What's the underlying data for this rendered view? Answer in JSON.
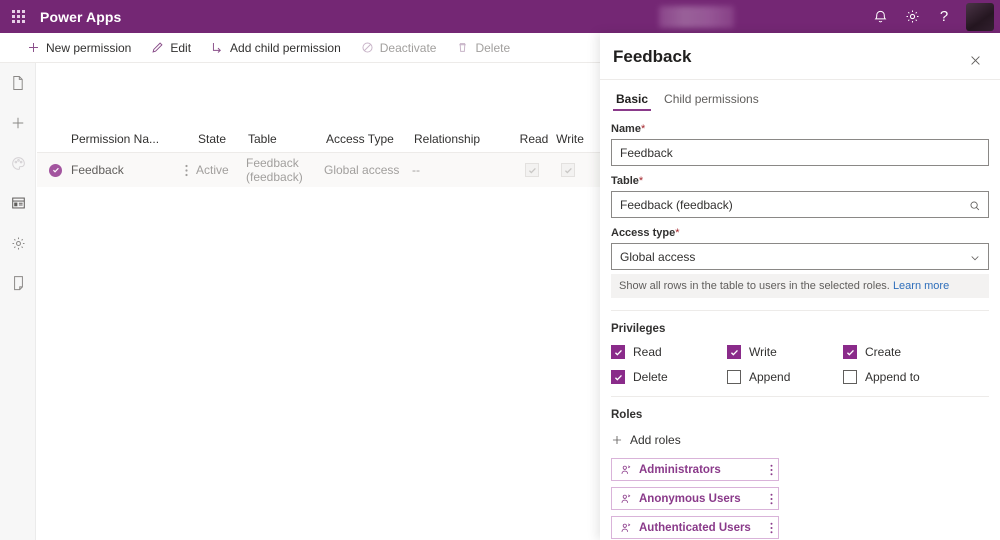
{
  "suite": {
    "waffle_icon": "waffle-grid-icon",
    "title": "Power Apps",
    "notifications_icon": "bell-icon",
    "settings_icon": "gear-icon",
    "help_icon": "question-mark-icon",
    "avatar_label": "",
    "brand_color": "#742774"
  },
  "commandbar": {
    "items": [
      {
        "label": "New permission",
        "icon": "plus-icon",
        "disabled": false
      },
      {
        "label": "Edit",
        "icon": "pencil-icon",
        "disabled": false
      },
      {
        "label": "Add child permission",
        "icon": "add-child-icon",
        "disabled": false
      },
      {
        "label": "Deactivate",
        "icon": "block-circle-icon",
        "disabled": true
      },
      {
        "label": "Delete",
        "icon": "trash-icon",
        "disabled": true
      }
    ]
  },
  "rail": {
    "items": [
      {
        "name": "pages-icon",
        "state": "normal"
      },
      {
        "name": "plus-icon",
        "state": "normal"
      },
      {
        "name": "theme-icon",
        "state": "muted"
      },
      {
        "name": "components-icon",
        "state": "dark"
      },
      {
        "name": "settings-icon",
        "state": "normal"
      },
      {
        "name": "preview-icon",
        "state": "normal"
      }
    ]
  },
  "grid": {
    "columns": [
      "Permission Na...",
      "State",
      "Table",
      "Access Type",
      "Relationship",
      "Read",
      "Write"
    ],
    "rows": [
      {
        "name": "Feedback",
        "state": "Active",
        "table": "Feedback (feedback)",
        "access_type": "Global access",
        "relationship": "--",
        "read": true,
        "write": true,
        "selected": true
      }
    ]
  },
  "panel": {
    "title": "Feedback",
    "close_icon": "close-icon",
    "tabs": [
      {
        "label": "Basic",
        "active": true
      },
      {
        "label": "Child permissions",
        "active": false
      }
    ],
    "fields": {
      "name": {
        "label": "Name",
        "required": "*",
        "value": "Feedback"
      },
      "table": {
        "label": "Table",
        "required": "*",
        "value": "Feedback (feedback)",
        "icon": "search-icon"
      },
      "access_type": {
        "label": "Access type",
        "required": "*",
        "value": "Global access",
        "icon": "chevron-down-icon",
        "help_text": "Show all rows in the table to users in the selected roles.",
        "help_link": "Learn more"
      }
    },
    "privileges": {
      "title": "Privileges",
      "items": [
        {
          "label": "Read",
          "checked": true
        },
        {
          "label": "Write",
          "checked": true
        },
        {
          "label": "Create",
          "checked": true
        },
        {
          "label": "Delete",
          "checked": true
        },
        {
          "label": "Append",
          "checked": false
        },
        {
          "label": "Append to",
          "checked": false
        }
      ]
    },
    "roles": {
      "title": "Roles",
      "add_label": "Add roles",
      "add_icon": "plus-icon",
      "items": [
        {
          "label": "Administrators",
          "icon": "person-icon",
          "overflow_icon": "more-vertical-icon"
        },
        {
          "label": "Anonymous Users",
          "icon": "person-icon",
          "overflow_icon": "more-vertical-icon"
        },
        {
          "label": "Authenticated Users",
          "icon": "person-icon",
          "overflow_icon": "more-vertical-icon"
        }
      ]
    }
  }
}
